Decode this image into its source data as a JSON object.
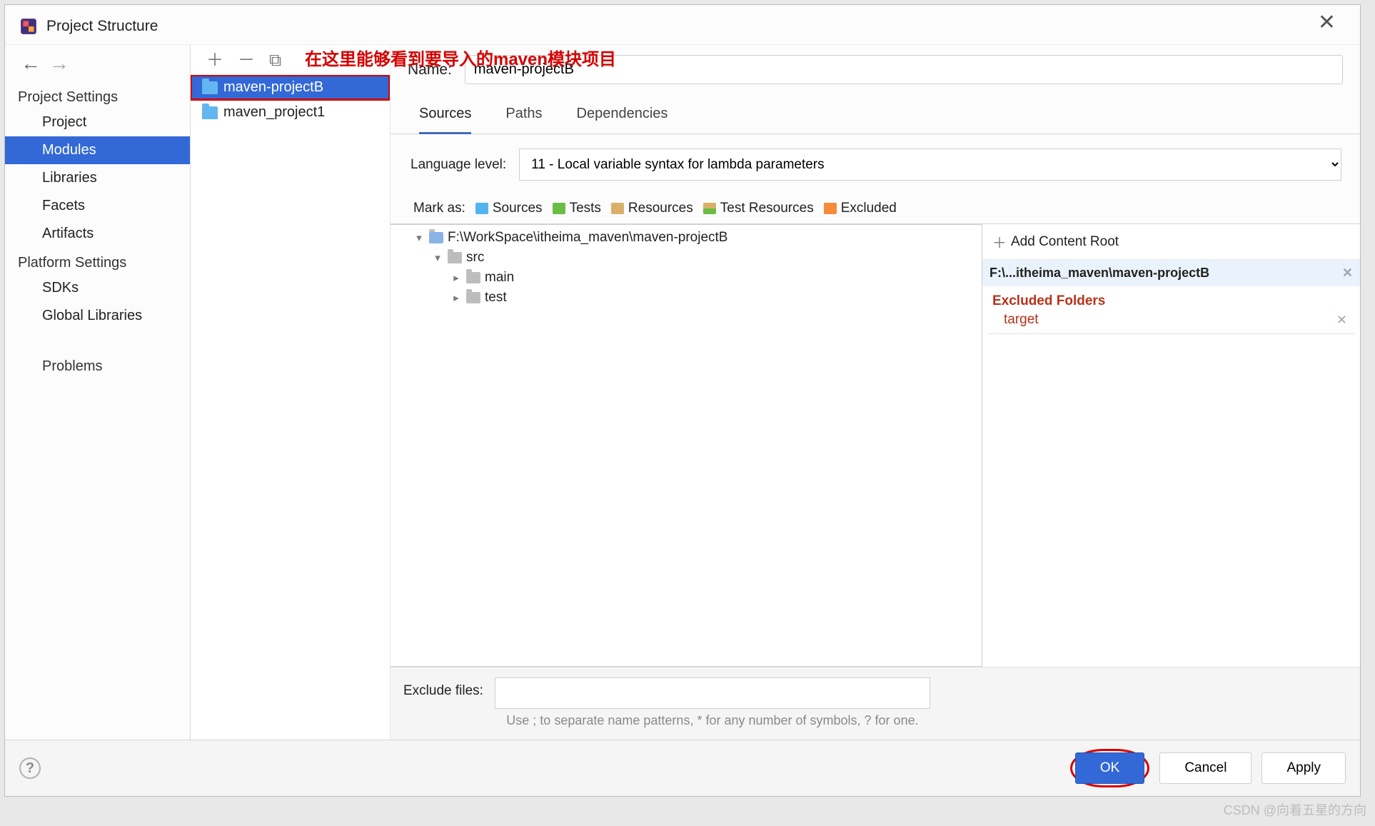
{
  "title": "Project Structure",
  "annotation": "在这里能够看到要导入的maven模块项目",
  "sidebar": {
    "group1_title": "Project Settings",
    "group1_items": [
      "Project",
      "Modules",
      "Libraries",
      "Facets",
      "Artifacts"
    ],
    "group1_selected_index": 1,
    "group2_title": "Platform Settings",
    "group2_items": [
      "SDKs",
      "Global Libraries"
    ],
    "problems": "Problems"
  },
  "modules": {
    "items": [
      "maven-projectB",
      "maven_project1"
    ],
    "selected_index": 0
  },
  "details": {
    "name_label": "Name:",
    "name_value": "maven-projectB",
    "tabs": [
      "Sources",
      "Paths",
      "Dependencies"
    ],
    "tab_selected_index": 0,
    "language_level_label": "Language level:",
    "language_level_value": "11 - Local variable syntax for lambda parameters",
    "mark_as_label": "Mark as:",
    "mark_options": [
      "Sources",
      "Tests",
      "Resources",
      "Test Resources",
      "Excluded"
    ],
    "tree": {
      "root": "F:\\WorkSpace\\itheima_maven\\maven-projectB",
      "src": "src",
      "main": "main",
      "test": "test"
    },
    "content_root": {
      "add_label": "Add Content Root",
      "path": "F:\\...itheima_maven\\maven-projectB",
      "excluded_title": "Excluded Folders",
      "excluded_items": [
        "target"
      ]
    },
    "exclude_files_label": "Exclude files:",
    "exclude_files_value": "",
    "exclude_hint": "Use ; to separate name patterns, * for any number of symbols, ? for one."
  },
  "footer": {
    "ok": "OK",
    "cancel": "Cancel",
    "apply": "Apply"
  },
  "watermark": "CSDN @向着五星的方向"
}
